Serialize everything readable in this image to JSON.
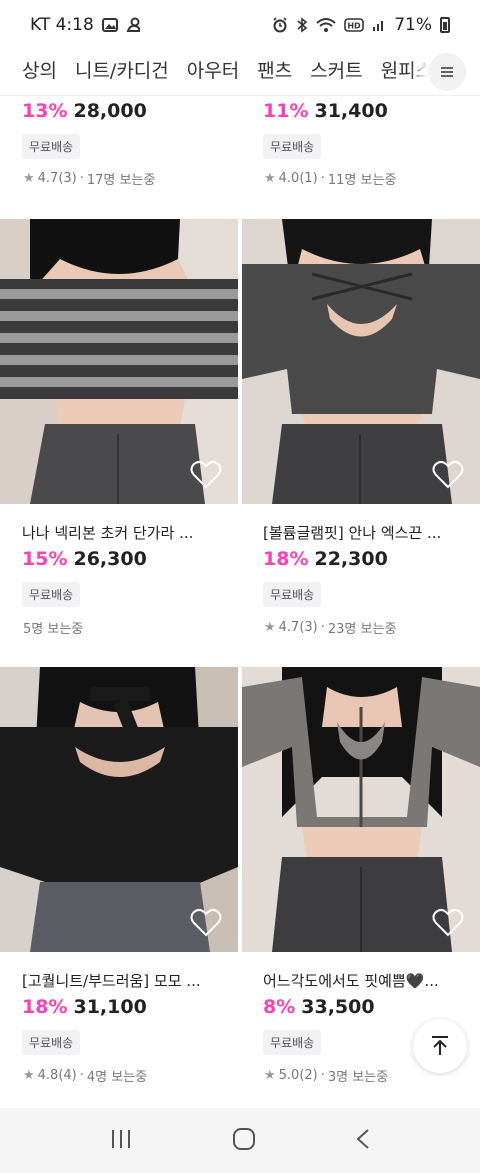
{
  "status_bar": {
    "carrier_time": "KT 4:18",
    "battery": "71%",
    "icons": [
      "image-icon",
      "bird-icon",
      "alarm-icon",
      "bluetooth-icon",
      "wifi-icon",
      "hd-icon",
      "signal-icon",
      "battery-icon"
    ]
  },
  "categories": [
    "상의",
    "니트/카디건",
    "아우터",
    "팬츠",
    "스커트",
    "원피스"
  ],
  "top_row": [
    {
      "discount": "13%",
      "price": "28,000",
      "badge": "무료배송",
      "rating": "4.7(3)",
      "views": "17명 보는중"
    },
    {
      "discount": "11%",
      "price": "31,400",
      "badge": "무료배송",
      "rating": "4.0(1)",
      "views": "11명 보는중"
    }
  ],
  "products": [
    {
      "title": "나나 넥리본 초커 단가라 ...",
      "discount": "15%",
      "price": "26,300",
      "badge": "무료배송",
      "rating": "",
      "views": "5명 보는중"
    },
    {
      "title": "[볼륨글램핏] 안나 엑스끈 ...",
      "discount": "18%",
      "price": "22,300",
      "badge": "무료배송",
      "rating": "4.7(3)",
      "views": "23명 보는중"
    },
    {
      "title": "[고퀄니트/부드러움] 모모 ...",
      "discount": "18%",
      "price": "31,100",
      "badge": "무료배송",
      "rating": "4.8(4)",
      "views": "4명 보는중"
    },
    {
      "title": "어느각도에서도 핏예쁨🖤...",
      "discount": "8%",
      "price": "33,500",
      "badge": "무료배송",
      "rating": "5.0(2)",
      "views": "3명 보는중"
    }
  ],
  "colors": {
    "discount": "#ff3fb4",
    "badge_bg": "#f2f2f4",
    "nav_bg": "#f5f5f5"
  }
}
